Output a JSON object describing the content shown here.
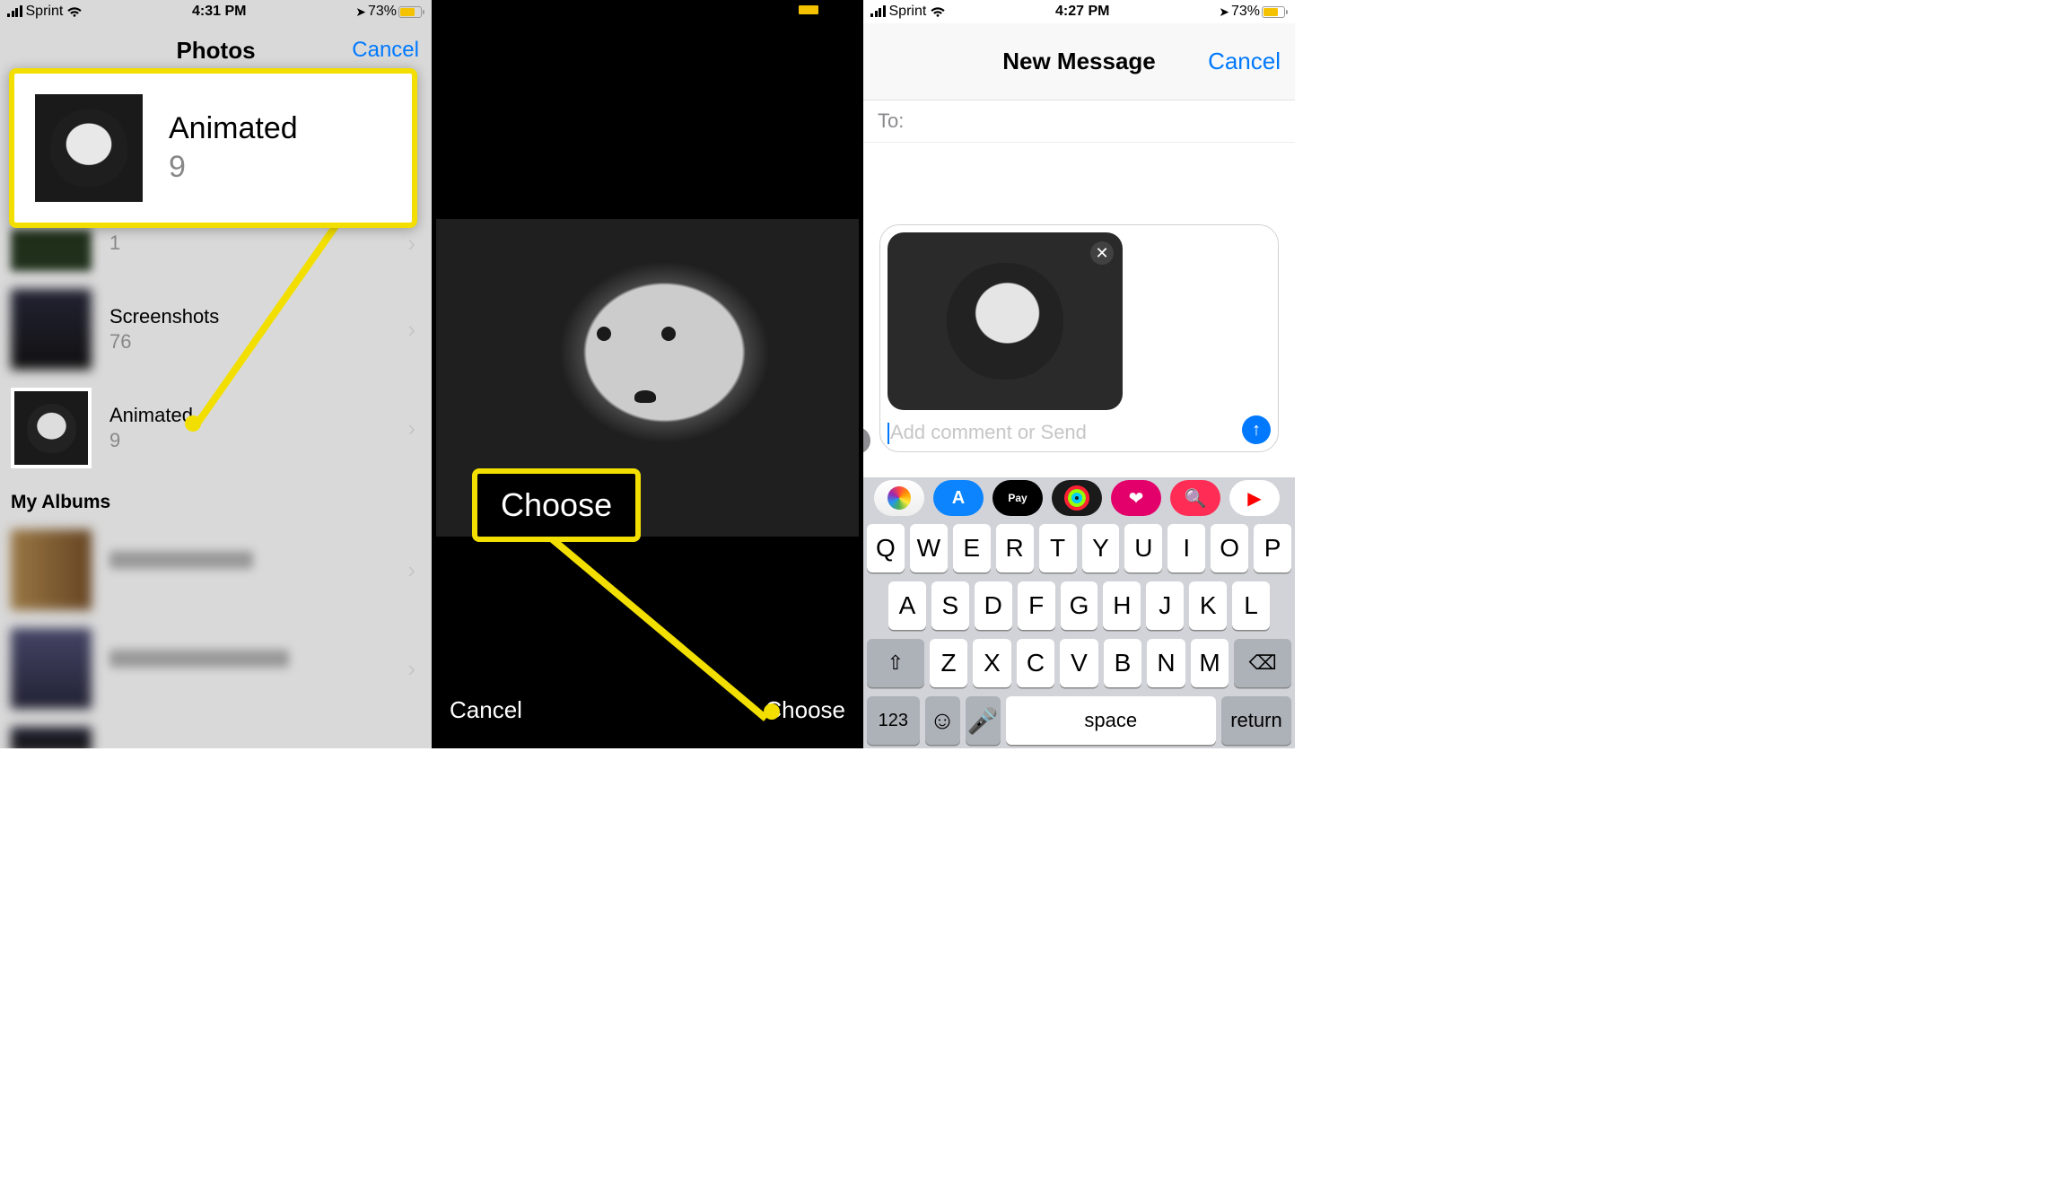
{
  "status": {
    "carrier": "Sprint",
    "time1": "4:31 PM",
    "time3": "4:27 PM",
    "battery_pct": "73%",
    "battery_color": "#f4c200",
    "battery_width_pct": 73
  },
  "screen1": {
    "nav_title": "Photos",
    "nav_cancel": "Cancel",
    "callout": {
      "name": "Animated",
      "count": "9"
    },
    "albums": [
      {
        "name": "",
        "count": "1",
        "blur_name": true,
        "thumb_class": "partial"
      },
      {
        "name": "Screenshots",
        "count": "76",
        "thumb_class": "blur2"
      },
      {
        "name": "Animated",
        "count": "9",
        "thumb_class": "cat"
      }
    ],
    "section_title": "My Albums",
    "my_albums": [
      {
        "thumb_class": "blur4"
      },
      {
        "thumb_class": "blur3"
      },
      {
        "thumb_class": "blur2"
      }
    ]
  },
  "screen2": {
    "choose_label_callout": "Choose",
    "cancel": "Cancel",
    "choose": "Choose"
  },
  "screen3": {
    "title": "New Message",
    "cancel": "Cancel",
    "to_label": "To:",
    "input_placeholder": "Add comment or Send",
    "apps": [
      "photos",
      "appstore",
      "pay",
      "fitness",
      "heart",
      "globe",
      "youtube"
    ],
    "keyboard": {
      "row1": [
        "Q",
        "W",
        "E",
        "R",
        "T",
        "Y",
        "U",
        "I",
        "O",
        "P"
      ],
      "row2": [
        "A",
        "S",
        "D",
        "F",
        "G",
        "H",
        "J",
        "K",
        "L"
      ],
      "row3": [
        "Z",
        "X",
        "C",
        "V",
        "B",
        "N",
        "M"
      ],
      "num_key": "123",
      "space": "space",
      "return": "return"
    }
  }
}
